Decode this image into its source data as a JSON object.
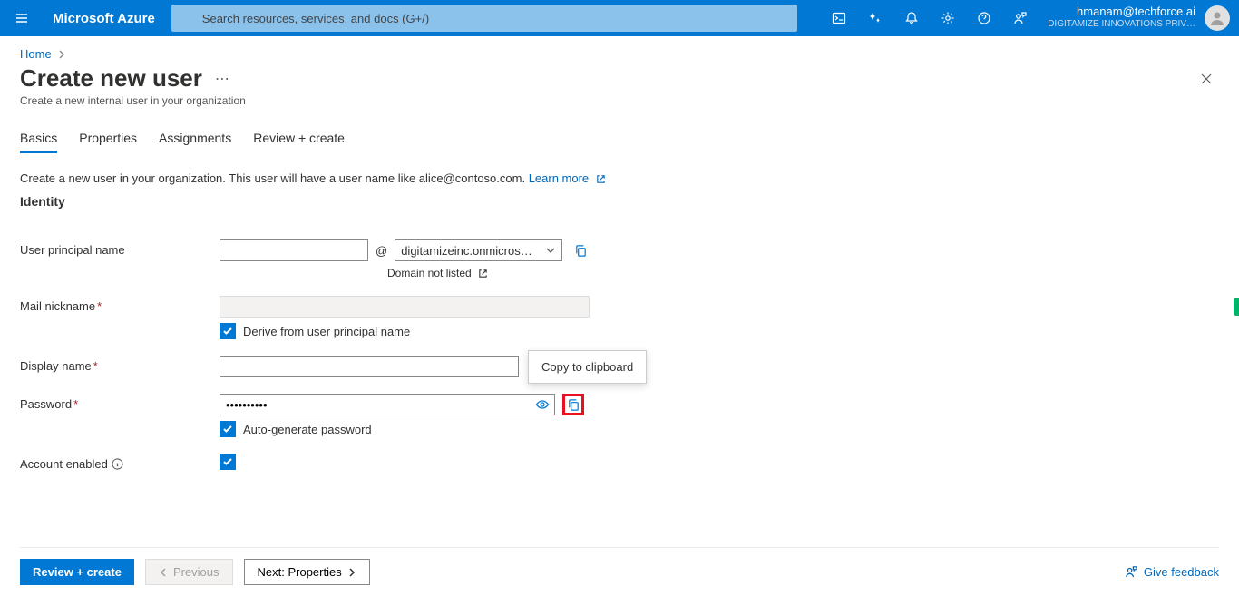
{
  "header": {
    "brand": "Microsoft Azure",
    "search_placeholder": "Search resources, services, and docs (G+/)",
    "user_email": "hmanam@techforce.ai",
    "user_org": "DIGITAMIZE INNOVATIONS PRIV…"
  },
  "breadcrumb": {
    "home": "Home"
  },
  "page": {
    "title": "Create new user",
    "subtitle": "Create a new internal user in your organization"
  },
  "tabs": {
    "basics": "Basics",
    "properties": "Properties",
    "assignments": "Assignments",
    "review": "Review + create"
  },
  "intro": {
    "text": "Create a new user in your organization. This user will have a user name like alice@contoso.com.",
    "learn_more": "Learn more"
  },
  "section": {
    "identity": "Identity"
  },
  "labels": {
    "upn": "User principal name",
    "mail_nickname": "Mail nickname",
    "display_name": "Display name",
    "password": "Password",
    "account_enabled": "Account enabled"
  },
  "values": {
    "at": "@",
    "domain": "digitamizeinc.onmicros…",
    "domain_not_listed": "Domain not listed",
    "derive_checkbox": "Derive from user principal name",
    "password_masked": "••••••••••",
    "autogenerate_checkbox": "Auto-generate password",
    "tooltip_copy": "Copy to clipboard"
  },
  "footer": {
    "review_create": "Review + create",
    "previous": "Previous",
    "next": "Next: Properties",
    "feedback": "Give feedback"
  }
}
